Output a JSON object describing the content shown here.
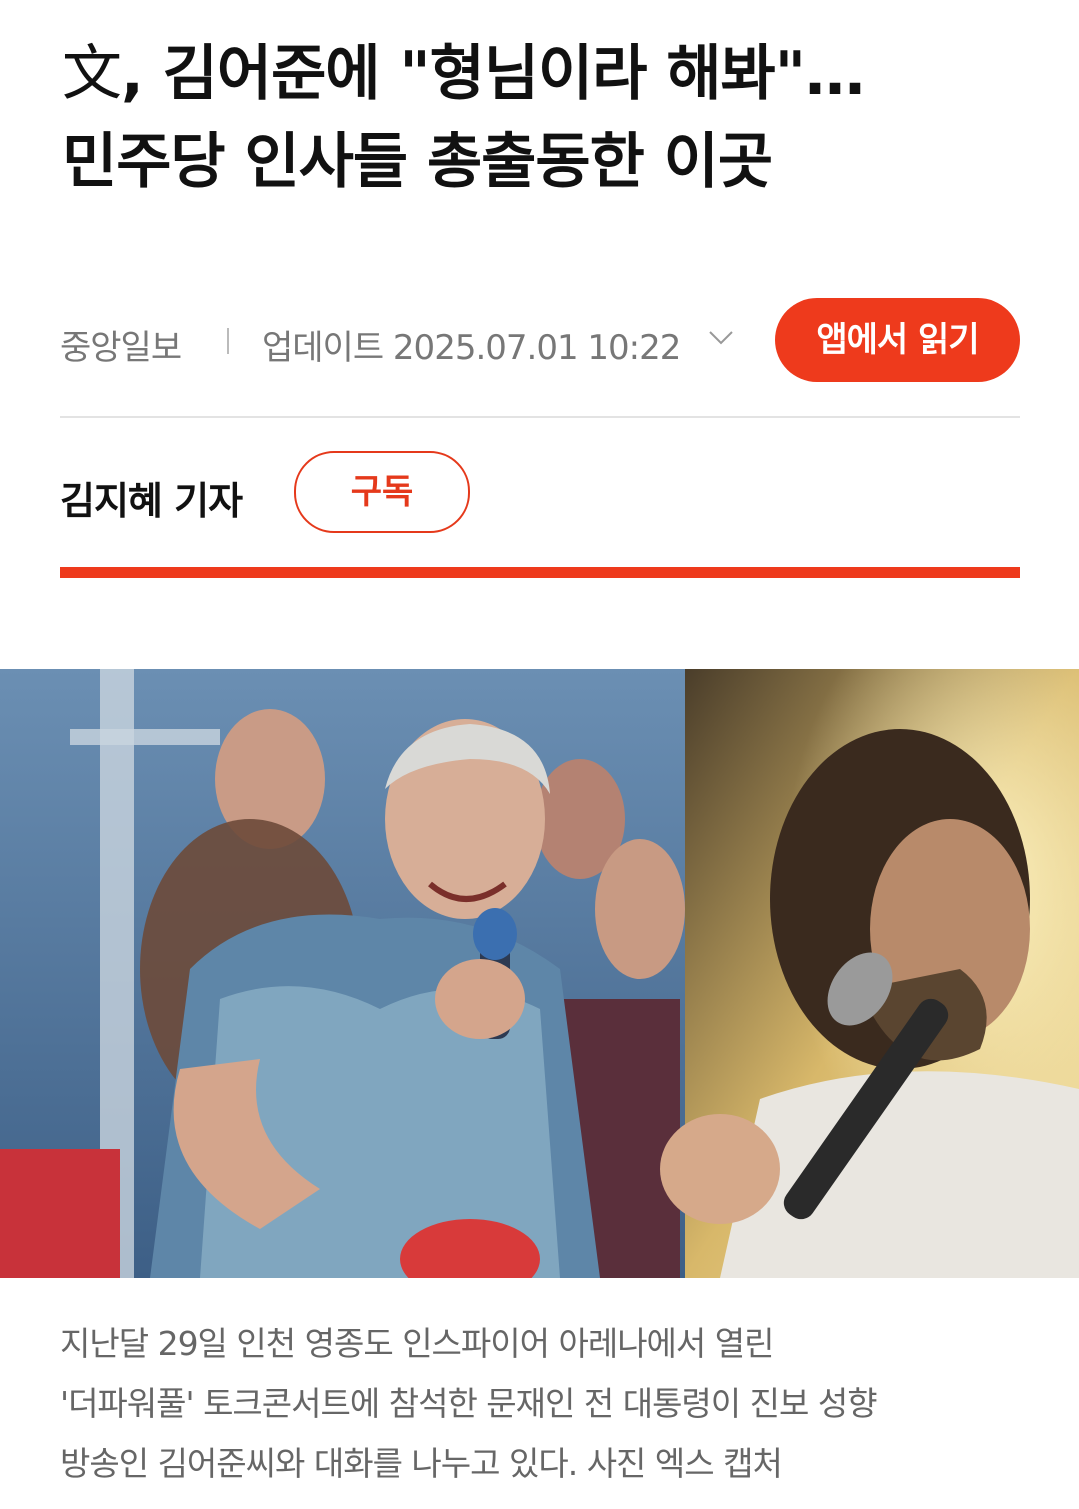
{
  "article": {
    "headline_hanja": "文",
    "headline_line1": ", 김어준에 \"형님이라 해봐\"…",
    "headline_line2": "민주당 인사들 총출동한 이곳"
  },
  "meta": {
    "publisher": "중앙일보",
    "update_label": "업데이트 2025.07.01 10:22",
    "app_button_label": "앱에서 읽기"
  },
  "byline": {
    "reporter": "김지혜 기자",
    "subscribe_label": "구독"
  },
  "photo": {
    "description_icon": "photo-image"
  },
  "caption": {
    "line1": "지난달 29일 인천 영종도 인스파이어 아레나에서 열린",
    "line2": "'더파워풀' 토크콘서트에 참석한 문재인 전 대통령이 진보 성향",
    "line3": "방송인 김어준씨와 대화를 나누고 있다. 사진 엑스 캡처"
  },
  "colors": {
    "accent": "#ee3a1c",
    "text_primary": "#111111",
    "text_secondary": "#777777"
  }
}
